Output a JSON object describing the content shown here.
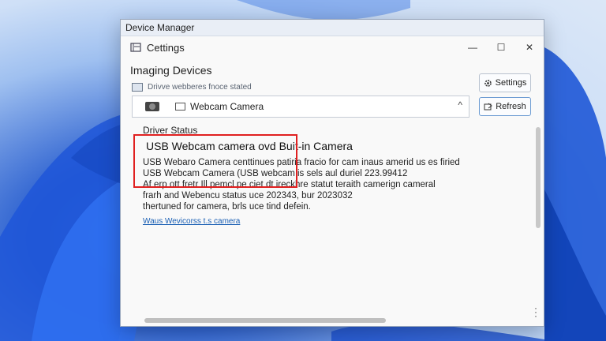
{
  "window": {
    "outer_title": "Device Manager",
    "inner_title": "Cettings",
    "minimize": "—",
    "maximize": "☐",
    "close": "✕"
  },
  "page": {
    "heading": "Imaging Devices",
    "subheading": "Drivve webberes fnoce stated"
  },
  "device_select": {
    "selected": "Webcam Camera",
    "chevron": "^"
  },
  "buttons": {
    "settings": "Settings",
    "refresh": "Refresh"
  },
  "driver_status": {
    "section_title": "Driver Status",
    "title": "USB Webcam camera ovd Buit-in Camera",
    "lines": [
      "USB Webaro Camera centtinues patiria fracio for cam inaus amerid us es firied",
      "USB Webcam Camera (USB webcam is sels aul duriel 223.99412",
      "Af erp ott fretr Ill pemcl pe ciet dt ireckhre statut teraith camerign cameral",
      "frarh and Webencu status uce 202343, bur 2023032",
      "thertuned for camera, brls uce tind defein."
    ],
    "link": "Waus Wevicorss t.s camera"
  },
  "icons": [
    "gear-icon",
    "monitor-icon",
    "camera-icon",
    "chevron-up-icon",
    "refresh-icon",
    "more-icon"
  ],
  "colors": {
    "highlight": "#e02020",
    "link": "#1a5fb4",
    "accent": "#2a5fcf"
  }
}
